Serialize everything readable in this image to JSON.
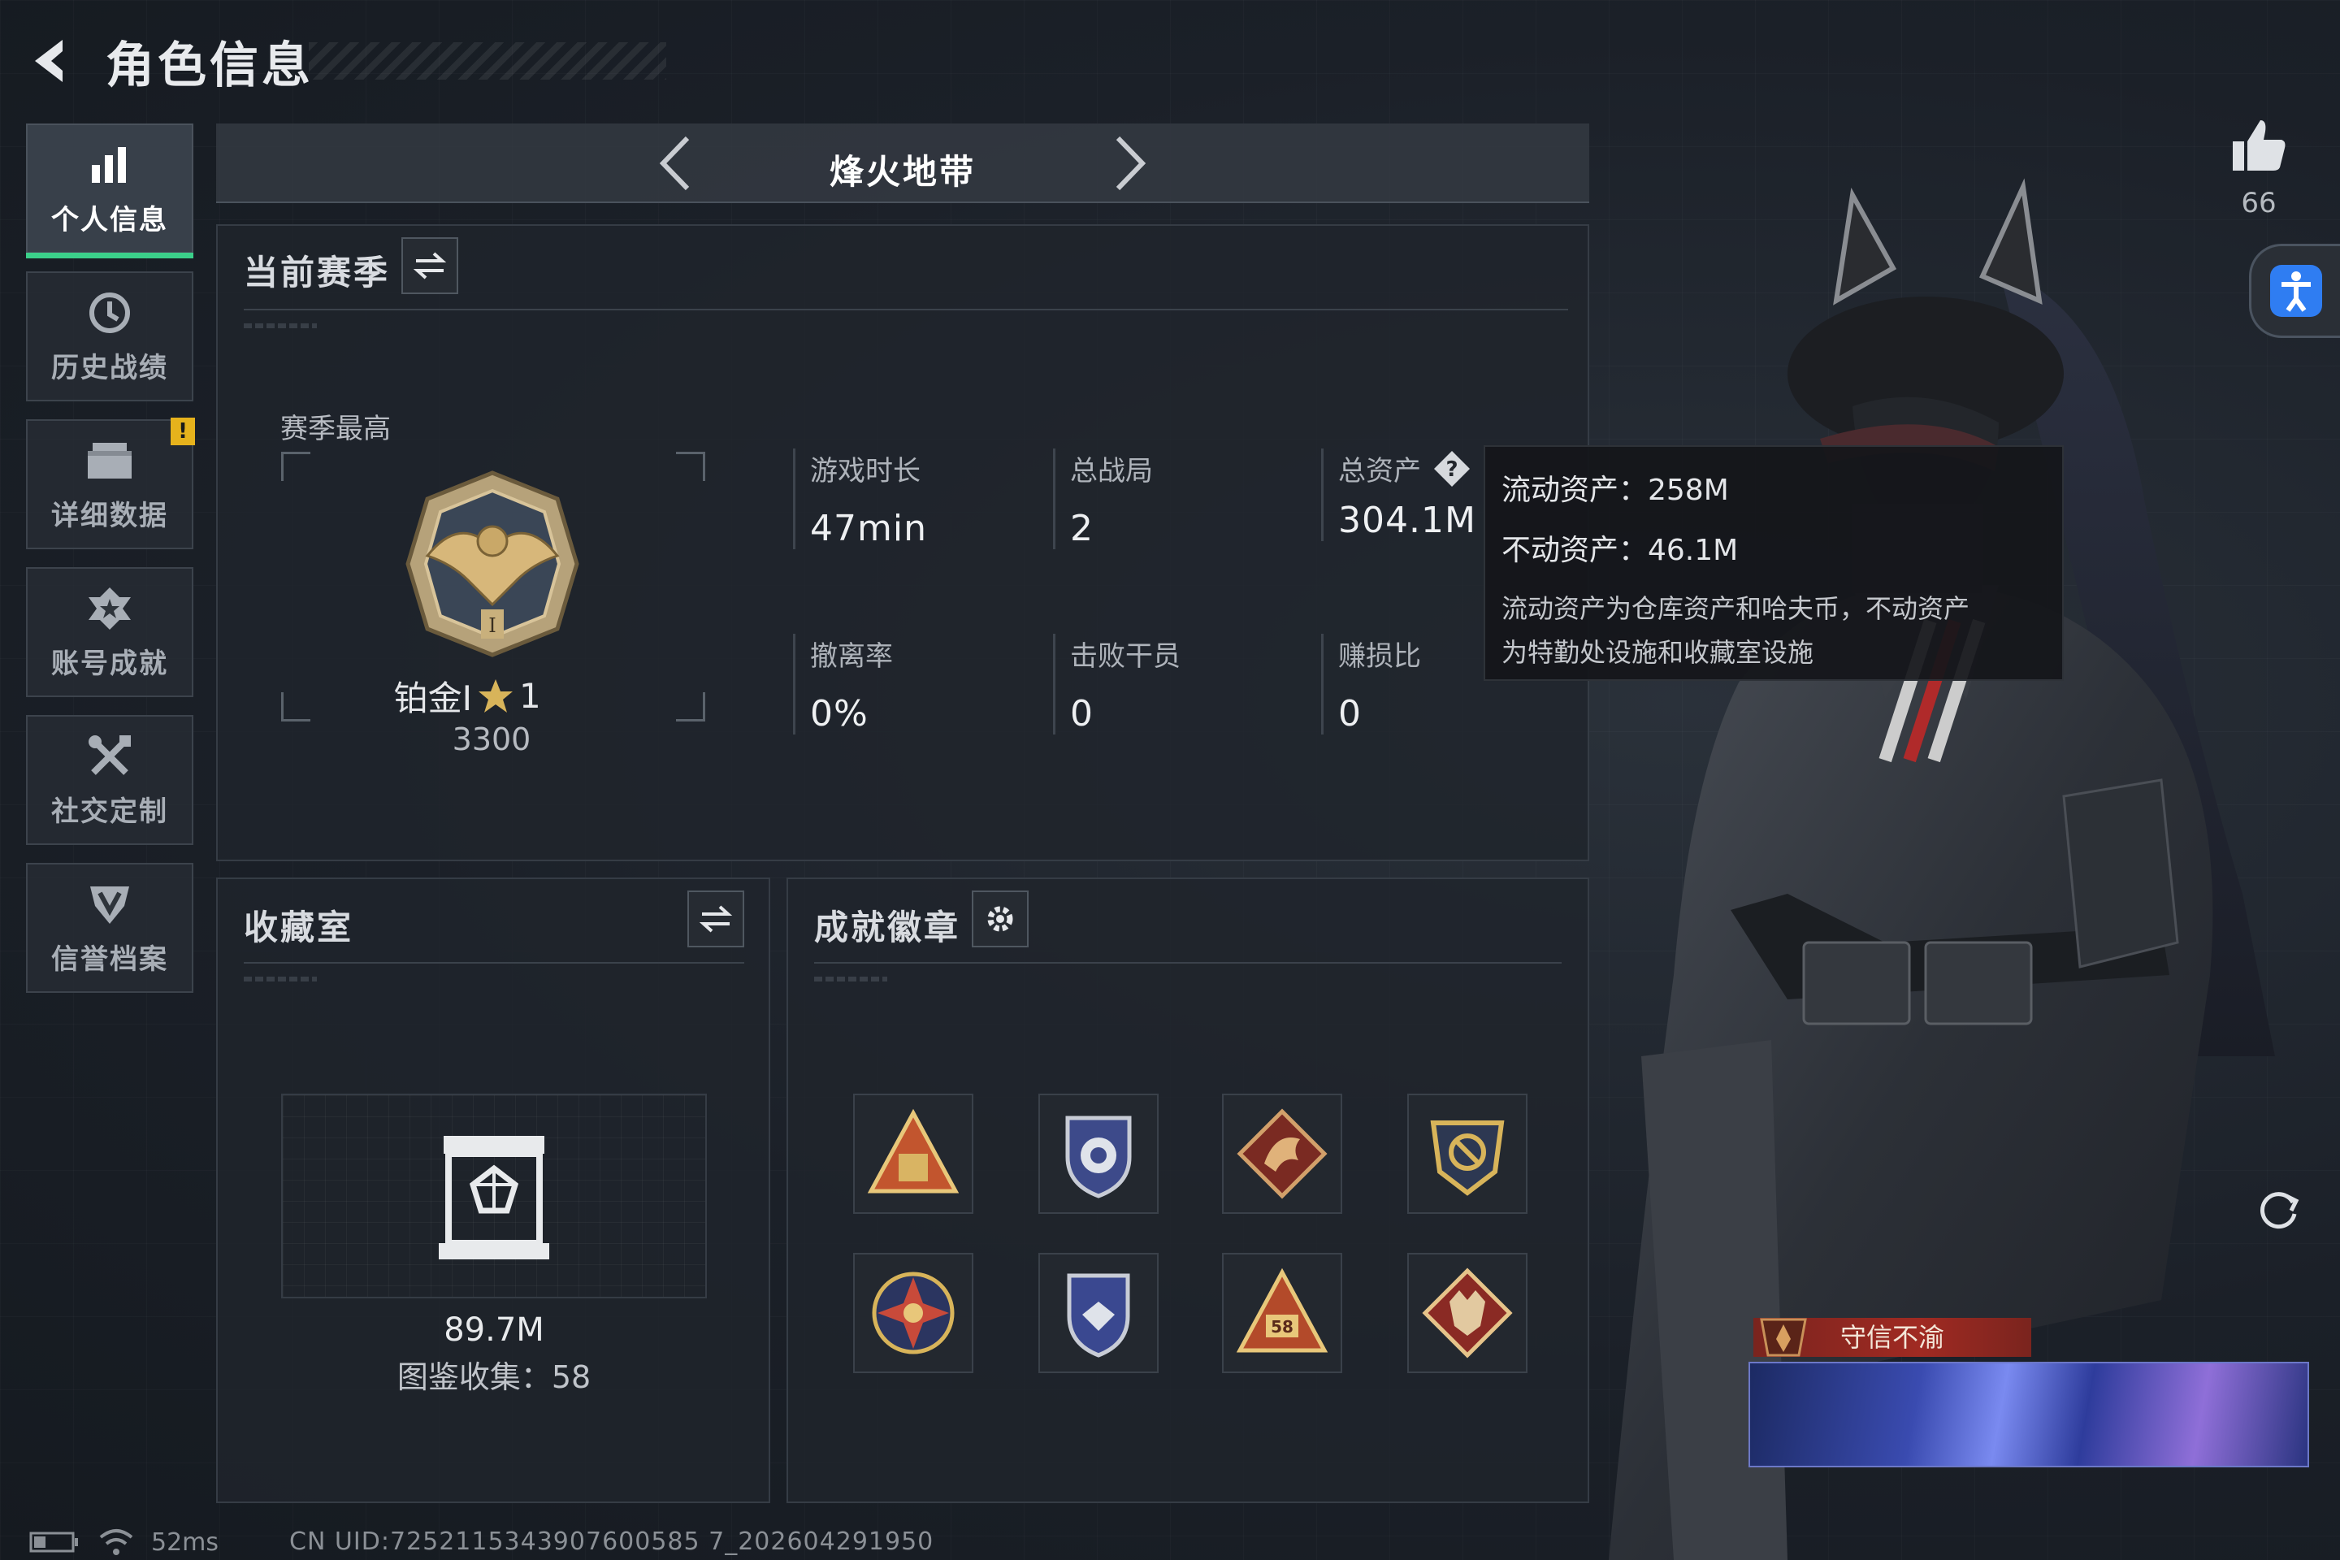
{
  "header": {
    "title": "角色信息"
  },
  "sidebar": {
    "items": [
      {
        "label": "个人信息",
        "icon": "bar-chart-icon",
        "active": true
      },
      {
        "label": "历史战绩",
        "icon": "history-clock-icon",
        "active": false
      },
      {
        "label": "详细数据",
        "icon": "folder-icon",
        "active": false,
        "badge": "!"
      },
      {
        "label": "账号成就",
        "icon": "achievement-star-icon",
        "active": false
      },
      {
        "label": "社交定制",
        "icon": "tools-icon",
        "active": false
      },
      {
        "label": "信誉档案",
        "icon": "shield-rank-icon",
        "active": false
      }
    ]
  },
  "mode": {
    "title": "烽火地带"
  },
  "season": {
    "title": "当前赛季",
    "best_label": "赛季最高",
    "rank_name": "铂金I",
    "rank_stars": "1",
    "rank_score": "3300",
    "stats": [
      {
        "label": "游戏时长",
        "value": "47min"
      },
      {
        "label": "总战局",
        "value": "2"
      },
      {
        "label": "总资产",
        "value": "304.1M",
        "has_help": true
      },
      {
        "label": "撤离率",
        "value": "0%"
      },
      {
        "label": "击败干员",
        "value": "0"
      },
      {
        "label": "赚损比",
        "value": "0"
      }
    ]
  },
  "tooltip": {
    "liquid": "流动资产：258M",
    "fixed": "不动资产：46.1M",
    "desc_line1": "流动资产为仓库资产和哈夫币，不动资产",
    "desc_line2": "为特勤处设施和收藏室设施"
  },
  "collection": {
    "title": "收藏室",
    "value": "89.7M",
    "count_text": "图鉴收集：58"
  },
  "achievements": {
    "title": "成就徽章",
    "badges": [
      "pyramid-badge-icon",
      "shield-eye-badge-icon",
      "dragon-badge-icon",
      "eagle-shield-badge-icon",
      "star-compass-badge-icon",
      "shield-wings-badge-icon",
      "pyramid-58-badge-icon",
      "wolf-badge-icon"
    ]
  },
  "player": {
    "likes": "66",
    "title_name": "守信不渝"
  },
  "status": {
    "ping": "52ms",
    "uid": "CN UID:7252115343907600585 7_202604291950"
  },
  "colors": {
    "accent_green": "#3bd08a",
    "warning_yellow": "#e6b21c",
    "title_red": "#a02a22",
    "access_blue": "#2f7df2"
  }
}
